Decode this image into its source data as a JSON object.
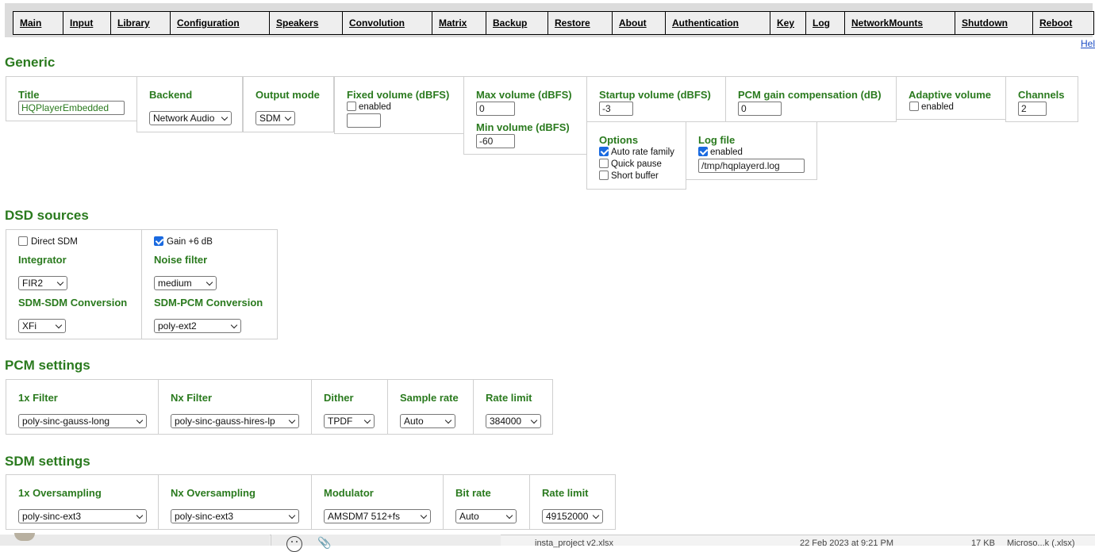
{
  "nav": {
    "items": [
      "Main",
      "Input",
      "Library",
      "Configuration",
      "Speakers",
      "Convolution",
      "Matrix",
      "Backup",
      "Restore",
      "About",
      "Authentication",
      "Key",
      "Log",
      "NetworkMounts",
      "Shutdown",
      "Reboot"
    ],
    "help": "Hel"
  },
  "generic": {
    "heading": "Generic",
    "title_label": "Title",
    "title_value": "HQPlayerEmbedded",
    "backend_label": "Backend",
    "backend_value": "Network Audio",
    "output_mode_label": "Output mode",
    "output_mode_value": "SDM",
    "fixed_volume_label": "Fixed volume (dBFS)",
    "fixed_volume_enabled_label": "enabled",
    "fixed_volume_enabled": false,
    "fixed_volume_value": "",
    "max_volume_label": "Max volume (dBFS)",
    "max_volume_value": "0",
    "min_volume_label": "Min volume (dBFS)",
    "min_volume_value": "-60",
    "startup_volume_label": "Startup volume (dBFS)",
    "startup_volume_value": "-3",
    "pcm_gain_label": "PCM gain compensation (dB)",
    "pcm_gain_value": "0",
    "adaptive_volume_label": "Adaptive volume",
    "adaptive_volume_enabled_label": "enabled",
    "adaptive_volume_enabled": false,
    "channels_label": "Channels",
    "channels_value": "2",
    "options_label": "Options",
    "options": [
      {
        "label": "Auto rate family",
        "checked": true
      },
      {
        "label": "Quick pause",
        "checked": false
      },
      {
        "label": "Short buffer",
        "checked": false
      }
    ],
    "log_file_label": "Log file",
    "log_file_enabled_label": "enabled",
    "log_file_enabled": true,
    "log_file_value": "/tmp/hqplayerd.log"
  },
  "dsd": {
    "heading": "DSD sources",
    "direct_sdm_label": "Direct SDM",
    "direct_sdm": false,
    "gain_label": "Gain +6 dB",
    "gain": true,
    "integrator_label": "Integrator",
    "integrator_value": "FIR2",
    "noise_filter_label": "Noise filter",
    "noise_filter_value": "medium",
    "sdm_sdm_label": "SDM-SDM Conversion",
    "sdm_sdm_value": "XFi",
    "sdm_pcm_label": "SDM-PCM Conversion",
    "sdm_pcm_value": "poly-ext2"
  },
  "pcm": {
    "heading": "PCM settings",
    "filter1x_label": "1x Filter",
    "filter1x_value": "poly-sinc-gauss-long",
    "filterNx_label": "Nx Filter",
    "filterNx_value": "poly-sinc-gauss-hires-lp",
    "dither_label": "Dither",
    "dither_value": "TPDF",
    "sample_rate_label": "Sample rate",
    "sample_rate_value": "Auto",
    "rate_limit_label": "Rate limit",
    "rate_limit_value": "384000"
  },
  "sdm": {
    "heading": "SDM settings",
    "os1x_label": "1x Oversampling",
    "os1x_value": "poly-sinc-ext3",
    "osNx_label": "Nx Oversampling",
    "osNx_value": "poly-sinc-ext3",
    "modulator_label": "Modulator",
    "modulator_value": "AMSDM7 512+fs",
    "bit_rate_label": "Bit rate",
    "bit_rate_value": "Auto",
    "rate_limit_label": "Rate limit",
    "rate_limit_value": "49152000"
  },
  "background": {
    "file_name": "insta_project v2.xlsx",
    "file_date": "22 Feb 2023 at 9:21 PM",
    "file_size": "17 KB",
    "file_kind": "Microso...k (.xlsx)"
  }
}
